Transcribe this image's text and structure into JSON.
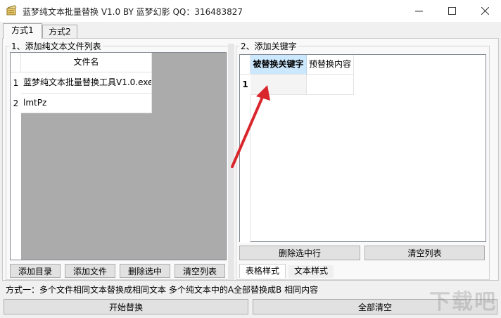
{
  "window": {
    "title": "蓝梦纯文本批量替换 V1.0 BY 蓝梦幻影 QQ：316483827",
    "minimize_glyph": "—",
    "maximize_glyph": "☐",
    "close_glyph": "✕"
  },
  "tabs": [
    {
      "label": "方式1"
    },
    {
      "label": "方式2"
    }
  ],
  "file_group": {
    "title": "1、添加纯文本文件列表",
    "column_header": "文件名",
    "rows": [
      {
        "num": "1",
        "name": "蓝梦纯文本批量替换工具V1.0.exe"
      },
      {
        "num": "2",
        "name": "lmtPz"
      }
    ],
    "buttons": {
      "add_dir": "添加目录",
      "add_file": "添加文件",
      "delete_selected": "删除选中",
      "clear_list": "清空列表"
    }
  },
  "keyword_group": {
    "title": "2、添加关键字",
    "col1_header": "被替换关键字",
    "col2_header": "预替换内容",
    "row_num": "1",
    "buttons": {
      "delete_row": "删除选中行",
      "clear_list": "清空列表"
    },
    "sub_tabs": [
      {
        "label": "表格样式"
      },
      {
        "label": "文本样式"
      }
    ]
  },
  "status_text": "方式一：多个文件相同文本替换成相同文本  多个纯文本中的A全部替换成B 相同内容",
  "bottom_buttons": {
    "start": "开始替换",
    "clear_all": "全部清空"
  },
  "watermark": "下载吧",
  "colors": {
    "selected_header": "#cce8ff",
    "arrow": "#d9262c"
  }
}
